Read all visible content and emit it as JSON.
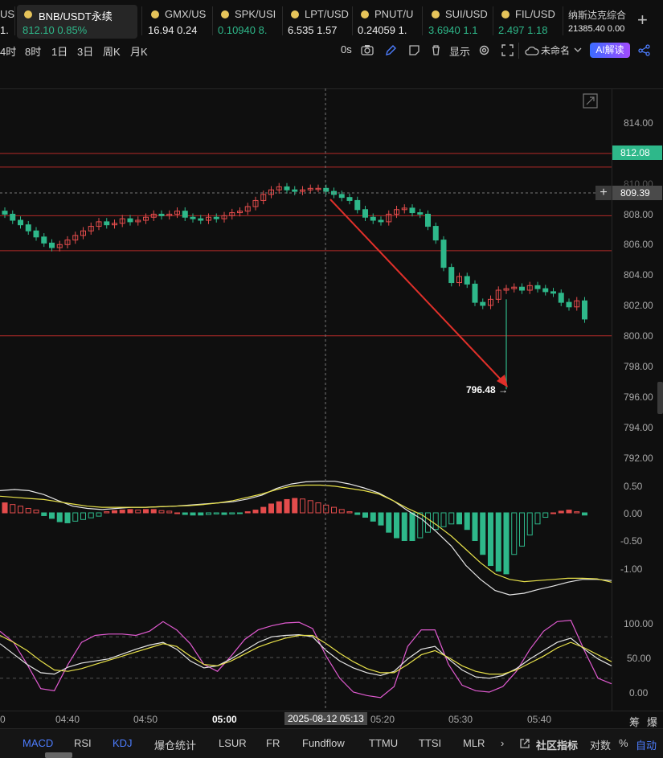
{
  "tickers": [
    {
      "name": "US",
      "value": "1.",
      "color": "#f0f0f0"
    },
    {
      "name": "BNB/USDT永续",
      "value": "812.10  0.85%",
      "color": "#2eb88a"
    },
    {
      "name": "GMX/US",
      "value": "16.94  0.24",
      "color": "#f0f0f0"
    },
    {
      "name": "SPK/USI",
      "value": "0.10940  8.",
      "color": "#2eb88a"
    },
    {
      "name": "LPT/USD",
      "value": "6.535  1.57",
      "color": "#f0f0f0"
    },
    {
      "name": "PNUT/U",
      "value": "0.24059  1.",
      "color": "#f0f0f0"
    },
    {
      "name": "SUI/USD",
      "value": "3.6940  1.1",
      "color": "#2eb88a"
    },
    {
      "name": "FIL/USD",
      "value": "2.497  1.18",
      "color": "#2eb88a"
    },
    {
      "name": "纳斯达克综合",
      "value": "21385.40  0.00",
      "color": "#f0f0f0"
    }
  ],
  "add_tab": "+",
  "toolbar": {
    "intervals": [
      "4时",
      "8时",
      "1日",
      "3日",
      "周K",
      "月K"
    ],
    "zero_s": "0s",
    "display": "显示",
    "unnamed": "未命名",
    "ai_label": "AI解读"
  },
  "price_axis": [
    "814.00",
    "812.00",
    "810.00",
    "808.00",
    "806.00",
    "804.00",
    "802.00",
    "800.00",
    "798.00",
    "796.00",
    "794.00",
    "792.00"
  ],
  "price_tags": {
    "current": "812.08",
    "crosshair": "809.39",
    "crosshair_plus": "+"
  },
  "low_label": "796.48 →",
  "macd_axis": [
    "0.50",
    "0.00",
    "-0.50",
    "-1.00"
  ],
  "kdj_axis": [
    "100.00",
    "50.00",
    "0.00"
  ],
  "time_axis": [
    "04:40",
    "04:50",
    "05:00",
    "05:20",
    "05:30",
    "05:40"
  ],
  "time_axis_cut": "0",
  "crosshair_time": "2025-08-12 05:13",
  "axis_corner": [
    "筹",
    "爆"
  ],
  "bottom_tabs": [
    "MACD",
    "RSI",
    "KDJ",
    "爆仓统计",
    "LSUR",
    "FR",
    "Fundflow",
    "TTMU",
    "TTSI",
    "MLR"
  ],
  "bottom_right": {
    "more": "›",
    "community": "社区指标",
    "log": "对数",
    "pct": "%",
    "auto": "自动"
  },
  "colors": {
    "up": "#e44c4c",
    "down": "#2eb88a",
    "accent": "#3b6cff",
    "yellow": "#e8e14a",
    "magenta": "#e05ad0"
  },
  "chart_data": [
    {
      "type": "candlestick",
      "x_ticks": [
        "04:40",
        "04:50",
        "05:00",
        "05:13",
        "05:20",
        "05:30",
        "05:40"
      ],
      "ylim": [
        791,
        815
      ],
      "horizontal_levels": [
        812.0,
        811.1,
        807.9,
        805.6,
        800.0
      ],
      "current_price": 812.08,
      "crosshair_price": 809.39,
      "marked_low": 796.48,
      "closes": [
        808.0,
        807.6,
        807.3,
        806.9,
        806.5,
        806.1,
        805.8,
        806.0,
        806.3,
        806.6,
        806.9,
        807.2,
        807.5,
        807.3,
        807.4,
        807.7,
        807.5,
        807.6,
        807.8,
        808.0,
        807.9,
        808.0,
        808.2,
        807.8,
        807.7,
        807.6,
        807.8,
        807.7,
        807.9,
        808.1,
        808.2,
        808.5,
        808.9,
        809.3,
        809.6,
        809.8,
        809.6,
        809.5,
        809.6,
        809.7,
        809.7,
        809.5,
        809.3,
        809.1,
        808.9,
        808.3,
        807.8,
        807.6,
        807.5,
        808.0,
        808.3,
        808.4,
        808.1,
        808.0,
        807.2,
        806.3,
        804.5,
        803.5,
        803.9,
        803.4,
        802.2,
        802.0,
        802.4,
        803.0,
        803.1,
        803.2,
        803.0,
        803.3,
        803.1,
        802.9,
        802.8,
        802.2,
        801.9,
        802.3,
        801.1
      ],
      "macd_histogram": [
        0.18,
        0.15,
        0.12,
        0.08,
        0.05,
        -0.05,
        -0.1,
        -0.16,
        -0.18,
        -0.15,
        -0.12,
        -0.09,
        -0.06,
        0.02,
        0.04,
        0.05,
        0.06,
        0.05,
        0.06,
        0.06,
        0.04,
        0.03,
        0.0,
        -0.03,
        -0.04,
        -0.04,
        -0.03,
        -0.02,
        -0.03,
        -0.02,
        -0.01,
        0.02,
        0.05,
        0.1,
        0.16,
        0.2,
        0.24,
        0.26,
        0.25,
        0.22,
        0.18,
        0.14,
        0.1,
        0.06,
        0.02,
        -0.03,
        -0.08,
        -0.15,
        -0.22,
        -0.35,
        -0.45,
        -0.5,
        -0.5,
        -0.45,
        -0.35,
        -0.3,
        -0.25,
        -0.2,
        -0.2,
        -0.3,
        -0.5,
        -0.75,
        -0.95,
        -1.05,
        -1.1,
        -0.75,
        -0.6,
        -0.4,
        -0.2,
        -0.08,
        0.0,
        0.03,
        0.05,
        0.02,
        -0.04
      ],
      "macd_dif": [
        0.4,
        0.42,
        0.4,
        0.33,
        0.22,
        0.12,
        0.08,
        0.06,
        0.08,
        0.1,
        0.1,
        0.11,
        0.12,
        0.14,
        0.16,
        0.18,
        0.2,
        0.25,
        0.32,
        0.44,
        0.52,
        0.56,
        0.57,
        0.57,
        0.52,
        0.45,
        0.36,
        0.22,
        0.04,
        -0.12,
        -0.35,
        -0.6,
        -0.95,
        -1.2,
        -1.4,
        -1.48,
        -1.45,
        -1.38,
        -1.32,
        -1.25,
        -1.2,
        -1.2,
        -1.22
      ],
      "macd_dea": [
        0.3,
        0.28,
        0.26,
        0.24,
        0.2,
        0.16,
        0.12,
        0.1,
        0.1,
        0.1,
        0.1,
        0.11,
        0.12,
        0.13,
        0.15,
        0.18,
        0.22,
        0.28,
        0.34,
        0.42,
        0.48,
        0.5,
        0.5,
        0.48,
        0.44,
        0.4,
        0.34,
        0.22,
        0.08,
        -0.04,
        -0.22,
        -0.42,
        -0.66,
        -0.9,
        -1.1,
        -1.2,
        -1.24,
        -1.22,
        -1.2,
        -1.18,
        -1.18,
        -1.19,
        -1.25
      ],
      "kdj_k": [
        70,
        55,
        40,
        28,
        26,
        36,
        42,
        45,
        48,
        55,
        62,
        68,
        72,
        62,
        45,
        35,
        38,
        48,
        60,
        72,
        80,
        82,
        83,
        80,
        60,
        45,
        35,
        28,
        24,
        30,
        48,
        62,
        66,
        48,
        32,
        22,
        20,
        24,
        34,
        48,
        60,
        72,
        78,
        62,
        48,
        38
      ],
      "kdj_d": [
        82,
        72,
        60,
        45,
        32,
        30,
        34,
        40,
        46,
        52,
        58,
        64,
        70,
        66,
        52,
        40,
        38,
        45,
        55,
        65,
        72,
        78,
        82,
        82,
        70,
        56,
        44,
        34,
        28,
        28,
        40,
        54,
        60,
        50,
        38,
        30,
        26,
        26,
        32,
        42,
        52,
        64,
        72,
        64,
        54,
        44
      ],
      "kdj_j": [
        88,
        72,
        40,
        5,
        2,
        40,
        72,
        82,
        84,
        84,
        82,
        88,
        102,
        90,
        70,
        40,
        30,
        52,
        76,
        90,
        96,
        100,
        101,
        92,
        52,
        20,
        0,
        -5,
        -8,
        8,
        66,
        90,
        90,
        40,
        10,
        2,
        0,
        8,
        30,
        62,
        88,
        102,
        104,
        60,
        20,
        12
      ]
    }
  ]
}
